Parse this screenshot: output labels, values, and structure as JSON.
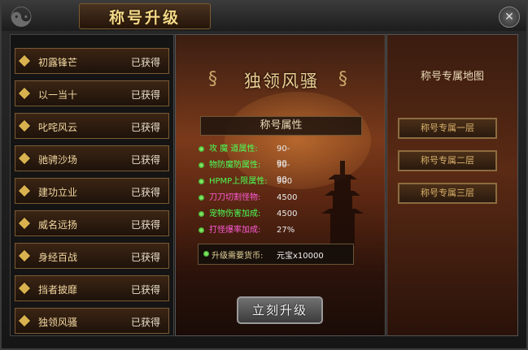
{
  "window": {
    "title": "称号升级",
    "close_icon": "close-icon"
  },
  "titles": [
    {
      "name": "初露锋芒",
      "status": "已获得"
    },
    {
      "name": "以一当十",
      "status": "已获得"
    },
    {
      "name": "叱咤风云",
      "status": "已获得"
    },
    {
      "name": "驰骋沙场",
      "status": "已获得"
    },
    {
      "name": "建功立业",
      "status": "已获得"
    },
    {
      "name": "威名远扬",
      "status": "已获得"
    },
    {
      "name": "身经百战",
      "status": "已获得"
    },
    {
      "name": "挡者披靡",
      "status": "已获得"
    },
    {
      "name": "独领风骚",
      "status": "已获得"
    }
  ],
  "selected": {
    "banner": "独领风骚",
    "attr_header": "称号属性",
    "attributes": [
      {
        "label": "攻 魔 道属性:",
        "value": "90-90",
        "color": "#4dff57"
      },
      {
        "label": "物防魔防属性:",
        "value": "90-90",
        "color": "#4dff57"
      },
      {
        "label": "HPMP上限属性:",
        "value": "900",
        "color": "#4dff57"
      },
      {
        "label": "刀刀切割怪物:",
        "value": "4500",
        "color": "#ff5bd6"
      },
      {
        "label": "宠物伤害加成:",
        "value": "4500",
        "color": "#4dff57"
      },
      {
        "label": "打怪爆率加成:",
        "value": "27%",
        "color": "#ff5bd6"
      }
    ],
    "cost_label": "升级需要货币:",
    "cost_value": "元宝x10000",
    "upgrade_label": "立刻升级"
  },
  "maps": {
    "title": "称号专属地图",
    "buttons": [
      "称号专属一层",
      "称号专属二层",
      "称号专属三层"
    ]
  }
}
